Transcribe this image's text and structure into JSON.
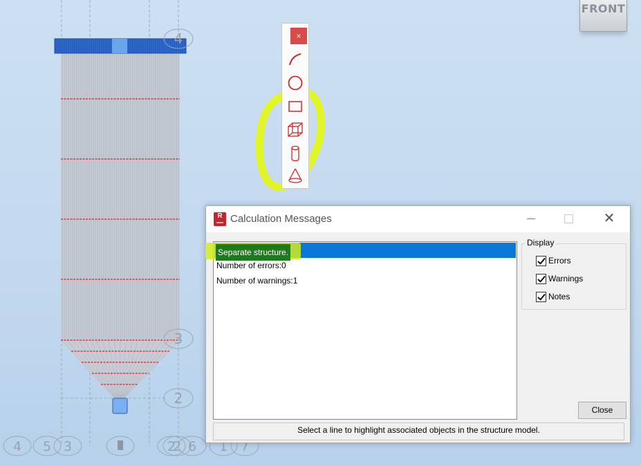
{
  "viewport": {
    "view_cube_label": "FRONT",
    "grid_bubbles_right": [
      "4",
      "3",
      "2"
    ],
    "grid_bubbles_bottom": [
      "4",
      "5",
      "3",
      "",
      "2",
      "2",
      "6",
      "1",
      "7"
    ],
    "colors": {
      "background_top": "#cde0f3",
      "silo_fill": "#c8cdd6",
      "silo_top_ring": "#2f6bd0",
      "ring_lines": "#e02020",
      "annotation_highlight": "#e4f51a"
    }
  },
  "shape_toolbar": {
    "close_glyph": "×",
    "tools": [
      "arc-icon",
      "circle-icon",
      "rectangle-icon",
      "box-icon",
      "cylinder-icon",
      "cone-icon"
    ],
    "icon_color": "#c92a2a"
  },
  "dialog": {
    "title": "Calculation Messages",
    "app_icon_letter": "R",
    "messages": [
      {
        "text": "Separate structure.",
        "selected": true
      },
      {
        "text": "Number of errors:0",
        "selected": false
      },
      {
        "text": "Number of warnings:1",
        "selected": false
      }
    ],
    "display": {
      "legend": "Display",
      "options": [
        {
          "label": "Errors",
          "checked": true
        },
        {
          "label": "Warnings",
          "checked": true
        },
        {
          "label": "Notes",
          "checked": true
        }
      ]
    },
    "close_label": "Close",
    "status_text": "Select a line to highlight associated objects in the structure model.",
    "selection_color": "#0a78d7"
  }
}
